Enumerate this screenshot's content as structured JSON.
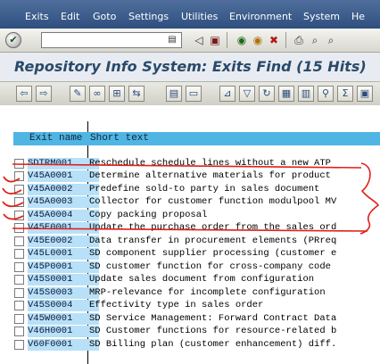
{
  "menu": {
    "items": [
      "Exits",
      "Edit",
      "Goto",
      "Settings",
      "Utilities",
      "Environment",
      "System",
      "He"
    ]
  },
  "toolbar": {
    "command_value": "",
    "enter_glyph": "✔"
  },
  "title": {
    "text": "Repository Info System: Exits Find (15 Hits)"
  },
  "list": {
    "columns": [
      "Exit name",
      "Short text"
    ],
    "rows": [
      {
        "name": "SDTRM001",
        "text": "Reschedule schedule lines without a new ATP"
      },
      {
        "name": "V45A0001",
        "text": "Determine alternative materials for product"
      },
      {
        "name": "V45A0002",
        "text": "Predefine sold-to party in sales document"
      },
      {
        "name": "V45A0003",
        "text": "Collector for customer function modulpool MV"
      },
      {
        "name": "V45A0004",
        "text": "Copy packing proposal"
      },
      {
        "name": "V45E0001",
        "text": "Update the purchase order from the sales ord"
      },
      {
        "name": "V45E0002",
        "text": "Data transfer in procurement elements (PRreq"
      },
      {
        "name": "V45L0001",
        "text": "SD component supplier processing (customer e"
      },
      {
        "name": "V45P0001",
        "text": "SD customer function for cross-company code"
      },
      {
        "name": "V45S0001",
        "text": "Update sales document from configuration"
      },
      {
        "name": "V45S0003",
        "text": "MRP-relevance for incomplete configuration"
      },
      {
        "name": "V45S0004",
        "text": "Effectivity type in sales order"
      },
      {
        "name": "V45W0001",
        "text": "SD Service Management: Forward Contract Data"
      },
      {
        "name": "V46H0001",
        "text": "SD Customer functions for resource-related b"
      },
      {
        "name": "V60F0001",
        "text": "SD Billing plan (customer enhancement) diff."
      }
    ]
  },
  "colors": {
    "menubar": "#3b5b8b",
    "header": "#4fb6e3",
    "name_cell": "#b8e0f8",
    "annotation": "#e0201a"
  }
}
